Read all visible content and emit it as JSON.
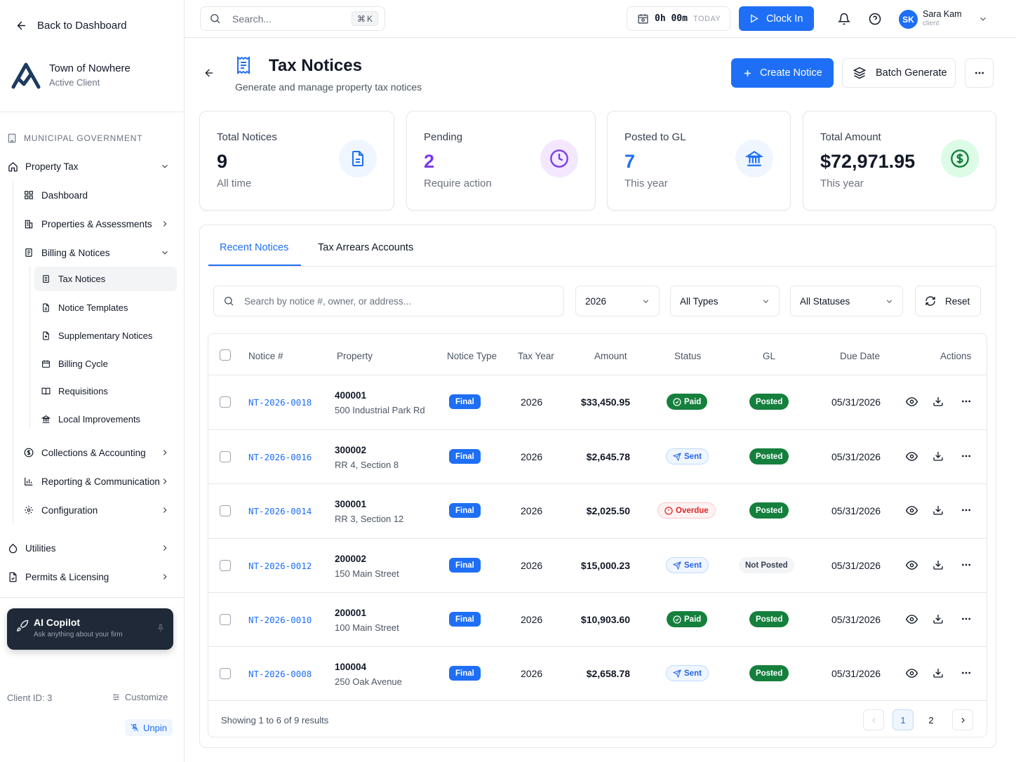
{
  "sidebar": {
    "back_label": "Back to Dashboard",
    "client_name": "Town of Nowhere",
    "client_status": "Active Client",
    "section_label": "MUNICIPAL GOVERNMENT",
    "property_tax": "Property Tax",
    "dashboard": "Dashboard",
    "properties": "Properties & Assessments",
    "billing": "Billing & Notices",
    "billing_items": [
      "Tax Notices",
      "Notice Templates",
      "Supplementary Notices",
      "Billing Cycle",
      "Requisitions",
      "Local Improvements"
    ],
    "collections": "Collections & Accounting",
    "reporting": "Reporting & Communication",
    "configuration": "Configuration",
    "utilities": "Utilities",
    "permits": "Permits & Licensing",
    "copilot_title": "AI Copilot",
    "copilot_sub": "Ask anything about your firm",
    "client_id": "Client ID: 3",
    "customize": "Customize",
    "unpin": "Unpin"
  },
  "topbar": {
    "search_placeholder": "Search...",
    "shortcut_key": "K",
    "timer_value": "0h 00m",
    "timer_label": "TODAY",
    "clock_in": "Clock In",
    "user_initials": "SK",
    "user_name": "Sara Kam",
    "user_role": "client"
  },
  "page": {
    "title": "Tax Notices",
    "subtitle": "Generate and manage property tax notices",
    "create_label": "Create Notice",
    "batch_label": "Batch Generate"
  },
  "stats": [
    {
      "label": "Total Notices",
      "value": "9",
      "sub": "All time"
    },
    {
      "label": "Pending",
      "value": "2",
      "sub": "Require action"
    },
    {
      "label": "Posted to GL",
      "value": "7",
      "sub": "This year"
    },
    {
      "label": "Total Amount",
      "value": "$72,971.95",
      "sub": "This year"
    }
  ],
  "tabs": [
    "Recent Notices",
    "Tax Arrears Accounts"
  ],
  "filters": {
    "search_placeholder": "Search by notice #, owner, or address...",
    "year": "2026",
    "type": "All Types",
    "status": "All Statuses",
    "reset": "Reset"
  },
  "table": {
    "headers": [
      "Notice #",
      "Property",
      "Notice Type",
      "Tax Year",
      "Amount",
      "Status",
      "GL",
      "Due Date",
      "Actions"
    ],
    "rows": [
      {
        "notice": "NT-2026-0018",
        "property_id": "400001",
        "address": "500 Industrial Park Rd",
        "type": "Final",
        "year": "2026",
        "amount": "$33,450.95",
        "status": "Paid",
        "gl": "Posted",
        "due": "05/31/2026"
      },
      {
        "notice": "NT-2026-0016",
        "property_id": "300002",
        "address": "RR 4, Section 8",
        "type": "Final",
        "year": "2026",
        "amount": "$2,645.78",
        "status": "Sent",
        "gl": "Posted",
        "due": "05/31/2026"
      },
      {
        "notice": "NT-2026-0014",
        "property_id": "300001",
        "address": "RR 3, Section 12",
        "type": "Final",
        "year": "2026",
        "amount": "$2,025.50",
        "status": "Overdue",
        "gl": "Posted",
        "due": "05/31/2026"
      },
      {
        "notice": "NT-2026-0012",
        "property_id": "200002",
        "address": "150 Main Street",
        "type": "Final",
        "year": "2026",
        "amount": "$15,000.23",
        "status": "Sent",
        "gl": "Not Posted",
        "due": "05/31/2026"
      },
      {
        "notice": "NT-2026-0010",
        "property_id": "200001",
        "address": "100 Main Street",
        "type": "Final",
        "year": "2026",
        "amount": "$10,903.60",
        "status": "Paid",
        "gl": "Posted",
        "due": "05/31/2026"
      },
      {
        "notice": "NT-2026-0008",
        "property_id": "100004",
        "address": "250 Oak Avenue",
        "type": "Final",
        "year": "2026",
        "amount": "$2,658.78",
        "status": "Sent",
        "gl": "Posted",
        "due": "05/31/2026"
      }
    ],
    "showing": "Showing 1 to 6 of 9 results",
    "pages": [
      "1",
      "2"
    ],
    "current_page": "1"
  },
  "colors": {
    "accent": "#1e6ff5",
    "purple": "#7c3aed",
    "green": "#15803d",
    "red": "#dc2626"
  }
}
